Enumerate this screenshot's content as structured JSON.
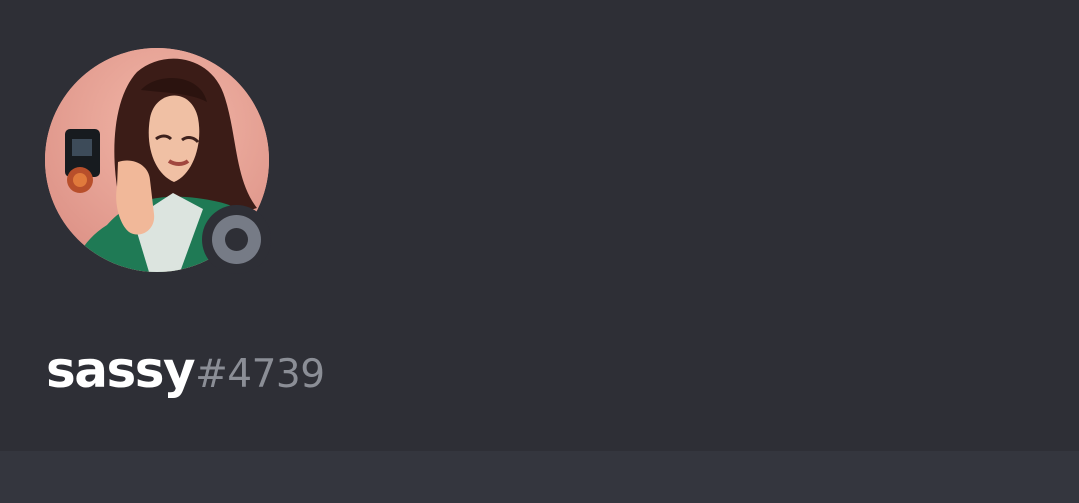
{
  "profile": {
    "username": "sassy",
    "discriminator": "#4739",
    "status": "offline",
    "avatar": "user-avatar-photo"
  },
  "colors": {
    "background": "#2e2f36",
    "footer": "#34363e",
    "username": "#ffffff",
    "discriminator": "#8b8e96",
    "status_offline": "#767b86"
  }
}
